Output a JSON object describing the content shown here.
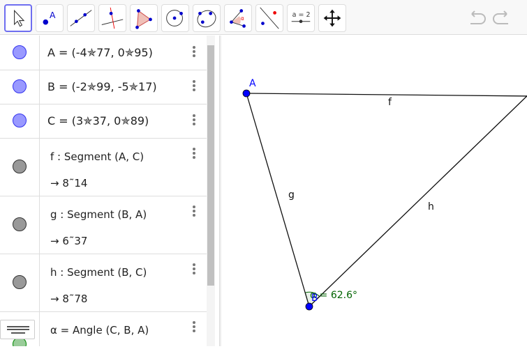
{
  "toolbar": {
    "tools": [
      "move-tool",
      "point-tool",
      "line-tool",
      "perpendicular-line-tool",
      "polygon-tool",
      "circle-center-point-tool",
      "conic-tool",
      "angle-tool",
      "reflect-tool",
      "slider-tool",
      "move-graphics-view-tool"
    ],
    "slider_label": "a = 2",
    "point_label": "A",
    "angle_symbol": "α",
    "selected": "move-tool"
  },
  "algebra": {
    "items": [
      {
        "text": "A = (-4✯77, 0✯95)",
        "color": "#9999ff"
      },
      {
        "text": "B = (-2✯99, -5✯17)",
        "color": "#9999ff"
      },
      {
        "text": "C = (3✯37, 0✯89)",
        "color": "#9999ff"
      },
      {
        "text": "f : Segment (A, C)",
        "value": "→  8˜14",
        "color": "#999999"
      },
      {
        "text": "g : Segment (B, A)",
        "value": "→  6˜37",
        "color": "#999999"
      },
      {
        "text": "h : Segment (B, C)",
        "value": "→  8˜78",
        "color": "#999999"
      },
      {
        "text": "α = Angle (C, B, A)",
        "color": "#009900"
      }
    ]
  },
  "graphics": {
    "labels": {
      "A": "A",
      "B": "B",
      "f": "f",
      "g": "g",
      "h": "h",
      "angle": "α = 62.6°"
    },
    "point_color": "#0000ff",
    "angle_color": "#006400"
  }
}
